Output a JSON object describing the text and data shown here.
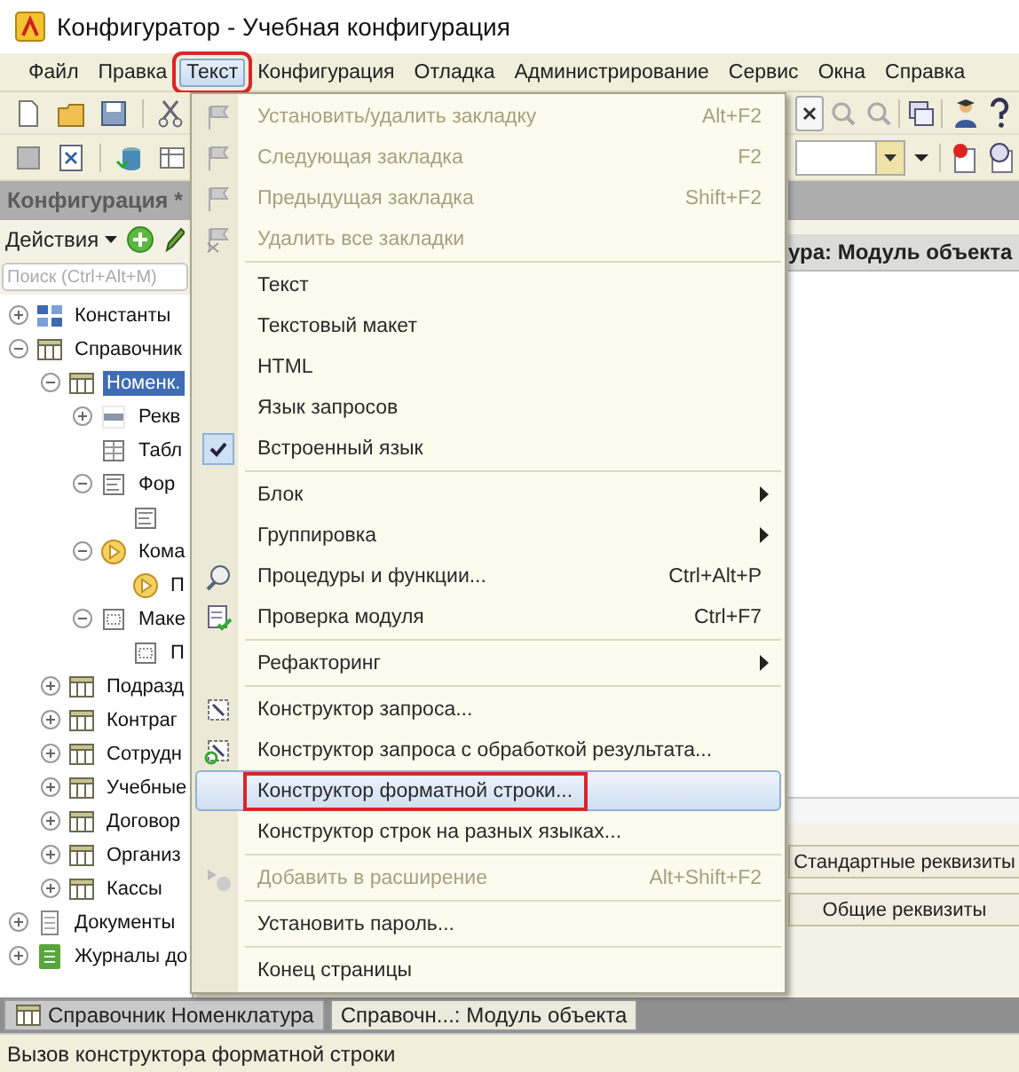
{
  "window": {
    "title": "Конфигуратор - Учебная конфигурация"
  },
  "menubar": {
    "items": [
      {
        "label": "Файл",
        "selected": false,
        "highlighted": false
      },
      {
        "label": "Правка",
        "selected": false,
        "highlighted": false
      },
      {
        "label": "Текст",
        "selected": true,
        "highlighted": true
      },
      {
        "label": "Конфигурация",
        "selected": false,
        "highlighted": false
      },
      {
        "label": "Отладка",
        "selected": false,
        "highlighted": false
      },
      {
        "label": "Администрирование",
        "selected": false,
        "highlighted": false
      },
      {
        "label": "Сервис",
        "selected": false,
        "highlighted": false
      },
      {
        "label": "Окна",
        "selected": false,
        "highlighted": false
      },
      {
        "label": "Справка",
        "selected": false,
        "highlighted": false
      }
    ]
  },
  "config_panel": {
    "title": "Конфигурация *",
    "actions_button": "Действия",
    "search": {
      "placeholder": "Поиск (Ctrl+Alt+M)"
    },
    "tree": [
      {
        "label": "Константы",
        "kind": "constants",
        "expanded": false,
        "selected": false
      },
      {
        "label": "Справочник",
        "kind": "catalog",
        "expanded": true,
        "selected": false,
        "children": [
          {
            "label": "Номенк.",
            "kind": "catalog",
            "expanded": true,
            "selected": true,
            "children": [
              {
                "label": "Рекв",
                "kind": "attribute",
                "expanded": false,
                "selected": false
              },
              {
                "label": "Табл",
                "kind": "table",
                "selected": false
              },
              {
                "label": "Фор",
                "kind": "form",
                "expanded": true,
                "selected": false,
                "children": [
                  {
                    "kind": "form"
                  }
                ]
              },
              {
                "label": "Кома",
                "kind": "command",
                "expanded": true,
                "selected": false,
                "children": [
                  {
                    "label": "П",
                    "kind": "command",
                    "selected": false
                  }
                ]
              },
              {
                "label": "Маке",
                "kind": "template",
                "expanded": true,
                "selected": false,
                "children": [
                  {
                    "label": "П",
                    "kind": "template",
                    "selected": false
                  }
                ]
              }
            ]
          },
          {
            "label": "Подразд",
            "kind": "catalog",
            "expanded": false,
            "selected": false
          },
          {
            "label": "Контраг",
            "kind": "catalog",
            "expanded": false,
            "selected": false
          },
          {
            "label": "Сотрудн",
            "kind": "catalog",
            "expanded": false,
            "selected": false
          },
          {
            "label": "Учебные",
            "kind": "catalog",
            "expanded": false,
            "selected": false
          },
          {
            "label": "Договор",
            "kind": "catalog",
            "expanded": false,
            "selected": false
          },
          {
            "label": "Организ",
            "kind": "catalog",
            "expanded": false,
            "selected": false
          },
          {
            "label": "Кассы",
            "kind": "catalog",
            "expanded": false,
            "selected": false
          }
        ]
      },
      {
        "label": "Документы",
        "kind": "document",
        "expanded": false,
        "selected": false
      },
      {
        "label": "Журналы до",
        "kind": "journal",
        "expanded": false,
        "selected": false
      }
    ]
  },
  "module_panel": {
    "title": "ура: Модуль объекта",
    "buttons": [
      "Стандартные реквизиты",
      "Общие реквизиты"
    ]
  },
  "text_menu": {
    "groups": [
      {
        "items": [
          {
            "label": "Установить/удалить закладку",
            "shortcut": "Alt+F2",
            "kind": "command",
            "disabled": true,
            "checked": false,
            "selected": false,
            "highlighted": false
          },
          {
            "label": "Следующая закладка",
            "shortcut": "F2",
            "kind": "command",
            "disabled": true,
            "checked": false,
            "selected": false,
            "highlighted": false
          },
          {
            "label": "Предыдущая закладка",
            "shortcut": "Shift+F2",
            "kind": "command",
            "disabled": true,
            "checked": false,
            "selected": false,
            "highlighted": false
          },
          {
            "label": "Удалить все закладки",
            "kind": "command",
            "disabled": true,
            "checked": false,
            "selected": false,
            "highlighted": false
          }
        ]
      },
      {
        "items": [
          {
            "label": "Текст",
            "kind": "command",
            "disabled": false,
            "checked": false,
            "selected": false,
            "highlighted": false
          },
          {
            "label": "Текстовый макет",
            "kind": "command",
            "disabled": false,
            "checked": false,
            "selected": false,
            "highlighted": false
          },
          {
            "label": "HTML",
            "kind": "command",
            "disabled": false,
            "checked": false,
            "selected": false,
            "highlighted": false
          },
          {
            "label": "Язык запросов",
            "kind": "command",
            "disabled": false,
            "checked": false,
            "selected": false,
            "highlighted": false
          },
          {
            "label": "Встроенный язык",
            "kind": "command",
            "disabled": false,
            "checked": true,
            "selected": false,
            "highlighted": false
          }
        ]
      },
      {
        "items": [
          {
            "label": "Блок",
            "kind": "submenu",
            "disabled": false,
            "checked": false,
            "selected": false,
            "highlighted": false
          },
          {
            "label": "Группировка",
            "kind": "submenu",
            "disabled": false,
            "checked": false,
            "selected": false,
            "highlighted": false
          },
          {
            "label": "Процедуры и функции...",
            "shortcut": "Ctrl+Alt+P",
            "kind": "command",
            "disabled": false,
            "checked": false,
            "selected": false,
            "highlighted": false
          },
          {
            "label": "Проверка модуля",
            "shortcut": "Ctrl+F7",
            "kind": "command",
            "disabled": false,
            "checked": false,
            "selected": false,
            "highlighted": false
          }
        ]
      },
      {
        "items": [
          {
            "label": "Рефакторинг",
            "kind": "submenu",
            "disabled": false,
            "checked": false,
            "selected": false,
            "highlighted": false
          }
        ]
      },
      {
        "items": [
          {
            "label": "Конструктор запроса...",
            "kind": "command",
            "disabled": false,
            "checked": false,
            "selected": false,
            "highlighted": false
          },
          {
            "label": "Конструктор запроса с обработкой результата...",
            "kind": "command",
            "disabled": false,
            "checked": false,
            "selected": false,
            "highlighted": false
          },
          {
            "label": "Конструктор форматной строки...",
            "kind": "command",
            "disabled": false,
            "checked": false,
            "selected": true,
            "highlighted": true
          },
          {
            "label": "Конструктор строк на разных языках...",
            "kind": "command",
            "disabled": false,
            "checked": false,
            "selected": false,
            "highlighted": false
          }
        ]
      },
      {
        "items": [
          {
            "label": "Добавить в расширение",
            "shortcut": "Alt+Shift+F2",
            "kind": "command",
            "disabled": true,
            "checked": false,
            "selected": false,
            "highlighted": false
          }
        ]
      },
      {
        "items": [
          {
            "label": "Установить пароль...",
            "kind": "command",
            "disabled": false,
            "checked": false,
            "selected": false,
            "highlighted": false
          }
        ]
      },
      {
        "items": [
          {
            "label": "Конец страницы",
            "kind": "command",
            "disabled": false,
            "checked": false,
            "selected": false,
            "highlighted": false
          }
        ]
      }
    ]
  },
  "window_tabs": [
    {
      "label": "Справочник Номенклатура",
      "selected": false
    },
    {
      "label": "Справочн...: Модуль объекта",
      "selected": true
    }
  ],
  "status_bar": "Вызов конструктора форматной строки"
}
